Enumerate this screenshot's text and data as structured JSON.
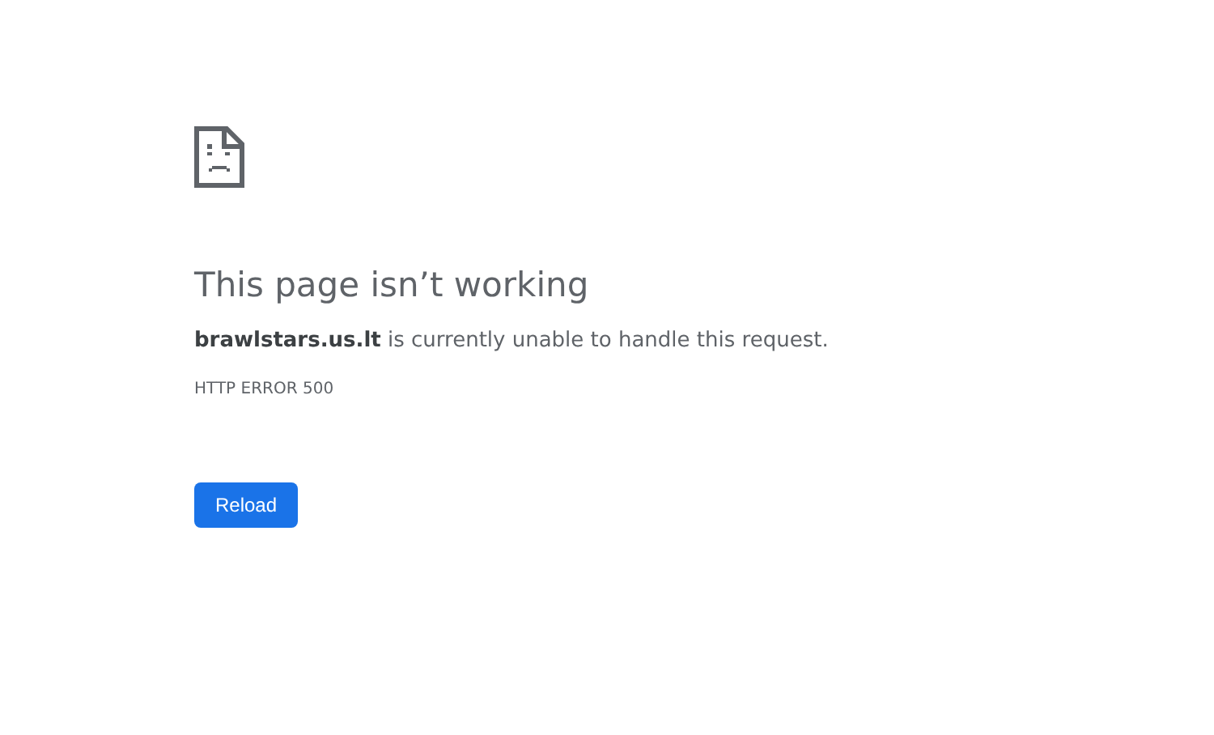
{
  "heading": "This page isn’t working",
  "message": "**brawlstars.us.lt** is currently unable to handle this request.",
  "error_code": "HTTP ERROR 500",
  "buttons": [
    {
      "label": "Reload"
    }
  ]
}
